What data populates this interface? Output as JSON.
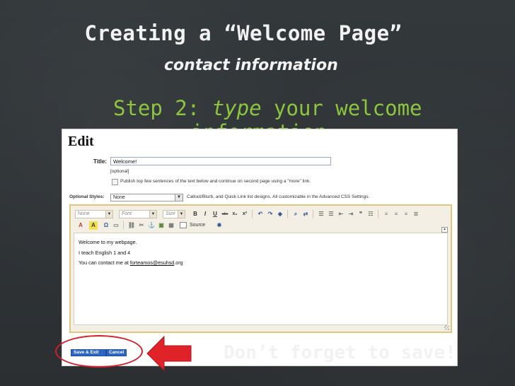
{
  "slide": {
    "title": "Creating a “Welcome Page”",
    "subtitle": "contact information",
    "step_prefix": "Step 2: ",
    "step_em": "type",
    "step_rest": " your welcome",
    "step_line2": "information",
    "reminder": "Don’t forget to save!"
  },
  "editor_page": {
    "heading": "Edit",
    "title_label": "Title:",
    "title_value": "Welcome!",
    "optional_note": "[optional]",
    "publish_checkbox_label": "Publish top few sentences of the text below and continue on second page using a \"more\" link.",
    "optional_styles_label": "Optional Styles:",
    "optional_styles_value": "None",
    "styles_help": "Callout/Blurb, and Quick Link list designs. All customizable in the Advanced CSS Settings.",
    "toolbar": {
      "format_value": "None",
      "font_value": "Font",
      "size_value": "Size",
      "bold": "B",
      "italic": "I",
      "underline": "U",
      "strike": "abc",
      "subscript": "x₂",
      "superscript": "x²",
      "source_label": "Source"
    },
    "content_lines": [
      "Welcome to my webpage.",
      "I teach English 1 and 4",
      "You can contact me at "
    ],
    "email": "forteamos@esuhsd",
    "email_suffix": ".org",
    "save_label": "Save & Exit",
    "cancel_label": "Cancel"
  },
  "colors": {
    "background": "#2f3336",
    "step_green": "#8cc63e",
    "highlight_red": "#d3202a",
    "button_blue": "#2d66c4"
  }
}
